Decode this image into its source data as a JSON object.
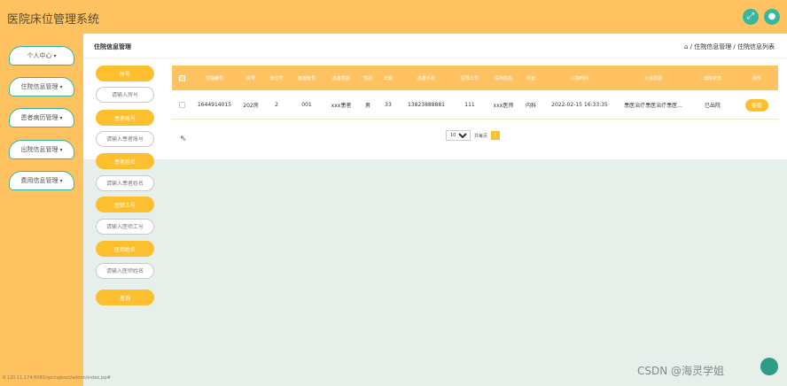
{
  "app": {
    "title": "医院床位管理系统"
  },
  "top_icons": [
    {
      "name": "fullscreen-icon",
      "glyph": "⤢"
    },
    {
      "name": "user-icon",
      "glyph": "●"
    }
  ],
  "sidebar": {
    "items": [
      {
        "label": "个人中心",
        "chev": "▾"
      },
      {
        "label": "住院信息管理",
        "chev": "▾"
      },
      {
        "label": "患者病历管理",
        "chev": "▾"
      },
      {
        "label": "出院信息管理",
        "chev": "▾"
      },
      {
        "label": "费用信息管理",
        "chev": "▾"
      }
    ]
  },
  "breadcrumb": {
    "title": "住院信息管理",
    "path": "⌂ / 住院信息管理 / 住院信息列表"
  },
  "filters": [
    {
      "label": "房号",
      "placeholder": "请输入房号"
    },
    {
      "label": "患者账号",
      "placeholder": "请输入患者账号"
    },
    {
      "label": "患者姓名",
      "placeholder": "请输入患者姓名"
    },
    {
      "label": "医师工号",
      "placeholder": "请输入医师工号"
    },
    {
      "label": "医师姓名",
      "placeholder": "请输入医师姓名"
    }
  ],
  "search_button": "查询",
  "table": {
    "headers": [
      "住院编号",
      "房号",
      "床位号",
      "患者账号",
      "患者姓名",
      "性别",
      "年龄",
      "患者手机",
      "医师工号",
      "医师姓名",
      "科室",
      "入院时间",
      "入住原因",
      "出院状态",
      "操作"
    ],
    "rows": [
      {
        "cells": [
          "1644914015",
          "202房",
          "2",
          "001",
          "xxx患者",
          "男",
          "33",
          "13823888881",
          "111",
          "xxx医师",
          "内科",
          "2022-02-15 16:33:35",
          "患医治疗患医治疗患医...",
          "已出院"
        ],
        "action": "查看"
      }
    ]
  },
  "pagination": {
    "page_size": "10",
    "text": "共每页",
    "page": "1"
  },
  "status_url": "8.120.11.174:8080/springboot/admin/index.jsp#",
  "watermark": "CSDN @海灵学姐",
  "colors": {
    "accent": "#fec360",
    "button": "#fdbf2d",
    "teal": "#35b89e"
  }
}
